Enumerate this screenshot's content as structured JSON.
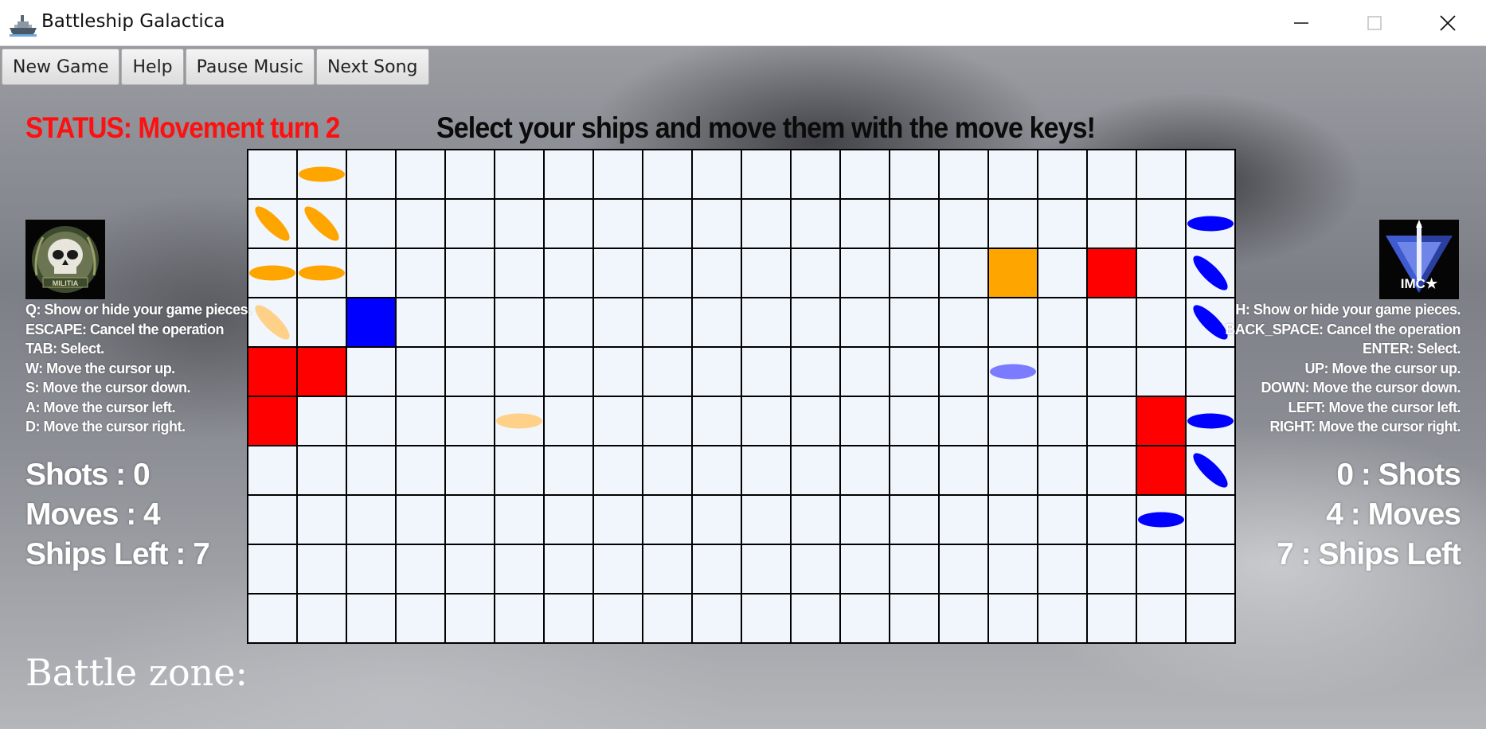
{
  "window": {
    "title": "Battleship Galactica",
    "icon": "battleship-icon",
    "controls": [
      "minimize-icon",
      "maximize-icon",
      "close-icon"
    ]
  },
  "toolbar": {
    "new_game": "New Game",
    "help": "Help",
    "pause_music": "Pause Music",
    "next_song": "Next Song"
  },
  "status": "STATUS: Movement  turn 2",
  "instruction": "Select your ships and move them with the move keys!",
  "left_player": {
    "emblem": "militia-skull-emblem",
    "emblem_text": "MILITIA",
    "controls": [
      "Q: Show or hide your game pieces.",
      "ESCAPE: Cancel the operation",
      "TAB: Select.",
      "W: Move the cursor up.",
      "S: Move the cursor down.",
      "A: Move the cursor left.",
      "D: Move the cursor right."
    ],
    "stats": [
      "Shots : 0",
      "Moves : 4",
      "Ships Left : 7"
    ]
  },
  "right_player": {
    "emblem": "imc-emblem",
    "emblem_text": "IMC★",
    "controls": [
      "H: Show or hide your game pieces.",
      "BACK_SPACE: Cancel the operation",
      "ENTER: Select.",
      "UP: Move the cursor up.",
      "DOWN: Move the cursor down.",
      "LEFT: Move the cursor left.",
      "RIGHT: Move the cursor right."
    ],
    "stats": [
      "0 : Shots",
      "4 : Moves",
      "7 : Ships Left"
    ]
  },
  "board": {
    "rows": 10,
    "cols": 20,
    "colors": {
      "cell": "#f0f6fc",
      "hit": "#ff0000",
      "cursor_orange": "#ffa500",
      "cursor_blue": "#0000ff",
      "ship_orange": "#ffa500",
      "ship_orange_faint": "#ffd188",
      "ship_blue": "#0000ff",
      "ship_blue_faint": "#7b7bff"
    },
    "filled_cells": [
      {
        "row": 2,
        "col": 15,
        "color": "orange"
      },
      {
        "row": 2,
        "col": 17,
        "color": "red"
      },
      {
        "row": 3,
        "col": 2,
        "color": "blue"
      },
      {
        "row": 4,
        "col": 0,
        "color": "red"
      },
      {
        "row": 4,
        "col": 1,
        "color": "red"
      },
      {
        "row": 5,
        "col": 0,
        "color": "red"
      },
      {
        "row": 5,
        "col": 18,
        "color": "red"
      },
      {
        "row": 6,
        "col": 18,
        "color": "red"
      }
    ],
    "ships": [
      {
        "row": 0,
        "col": 1,
        "color": "orange",
        "orientation": "horizontal"
      },
      {
        "row": 1,
        "col": 0,
        "color": "orange",
        "orientation": "diagonal"
      },
      {
        "row": 1,
        "col": 1,
        "color": "orange",
        "orientation": "diagonal"
      },
      {
        "row": 2,
        "col": 0,
        "color": "orange",
        "orientation": "horizontal"
      },
      {
        "row": 2,
        "col": 1,
        "color": "orange",
        "orientation": "horizontal"
      },
      {
        "row": 3,
        "col": 0,
        "color": "orange-faint",
        "orientation": "diagonal"
      },
      {
        "row": 5,
        "col": 5,
        "color": "orange-faint",
        "orientation": "horizontal"
      },
      {
        "row": 1,
        "col": 19,
        "color": "blue",
        "orientation": "horizontal"
      },
      {
        "row": 2,
        "col": 19,
        "color": "blue",
        "orientation": "diagonal"
      },
      {
        "row": 3,
        "col": 19,
        "color": "blue",
        "orientation": "diagonal"
      },
      {
        "row": 4,
        "col": 15,
        "color": "blue-faint",
        "orientation": "horizontal"
      },
      {
        "row": 5,
        "col": 19,
        "color": "blue",
        "orientation": "horizontal"
      },
      {
        "row": 6,
        "col": 19,
        "color": "blue",
        "orientation": "diagonal"
      },
      {
        "row": 7,
        "col": 18,
        "color": "blue",
        "orientation": "horizontal"
      }
    ]
  },
  "battle_zone_label": "Battle zone:"
}
